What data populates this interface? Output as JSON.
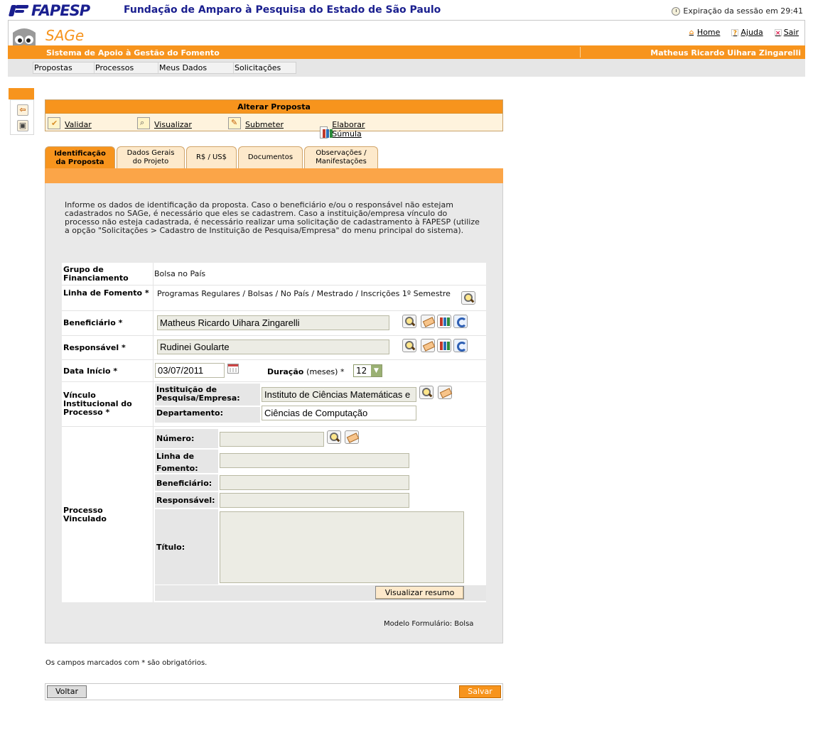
{
  "brand": {
    "logo_text": "FAPESP",
    "org_title": "Fundação de Amparo à Pesquisa do Estado de São Paulo",
    "session_text": "Expiração da sessão em 29:41"
  },
  "app": {
    "name": "SAGe",
    "subtitle": "Sistema de Apoio à Gestão do Fomento",
    "user": "Matheus Ricardo Uihara Zingarelli",
    "links": {
      "home": "Home",
      "help": "Ajuda",
      "exit": "Sair"
    }
  },
  "menu": [
    "Propostas",
    "Processos",
    "Meus Dados",
    "Solicitações"
  ],
  "panel": {
    "title": "Alterar Proposta",
    "actions": [
      "Validar",
      "Visualizar",
      "Submeter",
      "Elaborar Súmula"
    ]
  },
  "tabs": [
    {
      "line1": "Identificação",
      "line2": "da Proposta"
    },
    {
      "line1": "Dados Gerais",
      "line2": "do Projeto"
    },
    {
      "line1": "R$ / US$",
      "line2": ""
    },
    {
      "line1": "Documentos",
      "line2": ""
    },
    {
      "line1": "Observações /",
      "line2": "Manifestações"
    }
  ],
  "intro": "Informe os dados de identificação da proposta. Caso o beneficiário e/ou o responsável não estejam cadastrados no SAGe, é necessário que eles se cadastrem. Caso a instituição/empresa vínculo do processo não esteja cadastrada, é necessário realizar uma solicitação de cadastramento à FAPESP (utilize a opção \"Solicitações > Cadastro de Instituição de Pesquisa/Empresa\" do menu principal do sistema).",
  "form": {
    "grupo_label": "Grupo de Financiamento",
    "grupo_value": "Bolsa no País",
    "linha_label": "Linha de Fomento *",
    "linha_value": "Programas Regulares / Bolsas / No País / Mestrado / Inscrições 1º Semestre",
    "beneficiario_label": "Beneficiário *",
    "beneficiario_value": "Matheus Ricardo Uihara Zingarelli",
    "responsavel_label": "Responsável *",
    "responsavel_value": "Rudinei Goularte",
    "data_label": "Data Início *",
    "data_value": "03/07/2011",
    "duracao_label": "Duração",
    "duracao_unit": "(meses) *",
    "duracao_value": "12",
    "vinculo_label": "Vínculo Institucional do Processo *",
    "instituicao_label": "Instituição de Pesquisa/Empresa:",
    "instituicao_value": "Instituto de Ciências Matemáticas e",
    "departamento_label": "Departamento:",
    "departamento_value": "Ciências de Computação",
    "processo_label": "Processo Vinculado",
    "numero_label": "Número:",
    "linha_fomento_label": "Linha de Fomento:",
    "benef_label": "Beneficiário:",
    "resp_label": "Responsável:",
    "titulo_label": "Título:",
    "visualizar_resumo": "Visualizar resumo"
  },
  "modelo": "Modelo Formulário: Bolsa",
  "obrigatorios": "Os campos marcados com * são obrigatórios.",
  "buttons": {
    "voltar": "Voltar",
    "salvar": "Salvar"
  }
}
